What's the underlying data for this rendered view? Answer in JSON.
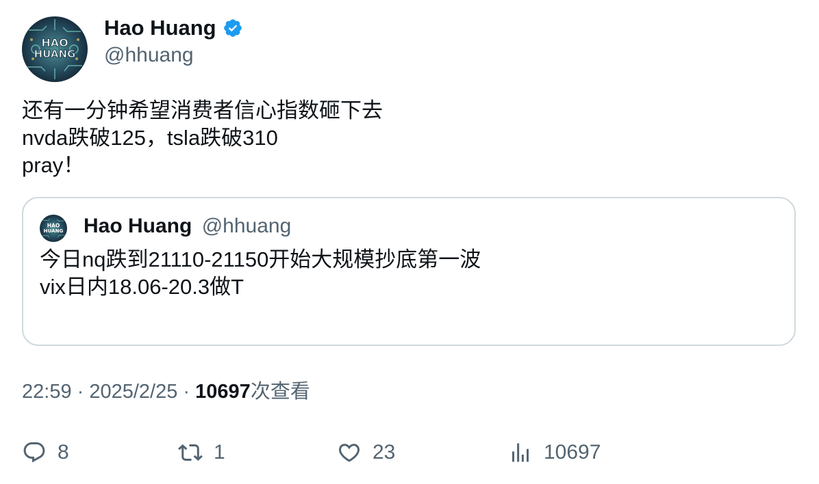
{
  "author": {
    "name": "Hao Huang",
    "handle": "@hhuang",
    "avatar_text_line1": "HAO",
    "avatar_text_line2": "HUANG",
    "verified": true
  },
  "tweet": {
    "lines": [
      "还有一分钟希望消费者信心指数砸下去",
      "nvda跌破125，tsla跌破310",
      "pray！"
    ]
  },
  "quoted": {
    "name": "Hao Huang",
    "handle": "@hhuang",
    "lines": [
      "今日nq跌到21110-21150开始大规模抄底第一波",
      "vix日内18.06-20.3做T"
    ]
  },
  "meta": {
    "time": "22:59",
    "sep1": " · ",
    "date": "2025/2/25",
    "sep2": " · ",
    "views_count": "10697",
    "views_label": "次查看"
  },
  "actions": {
    "replies": "8",
    "retweets": "1",
    "likes": "23",
    "views": "10697"
  },
  "colors": {
    "text": "#0f1419",
    "secondary": "#536471",
    "border": "#cfd9de",
    "verified": "#1d9bf0"
  },
  "icons": [
    "verified-badge-icon",
    "reply-icon",
    "retweet-icon",
    "like-icon",
    "views-icon"
  ]
}
